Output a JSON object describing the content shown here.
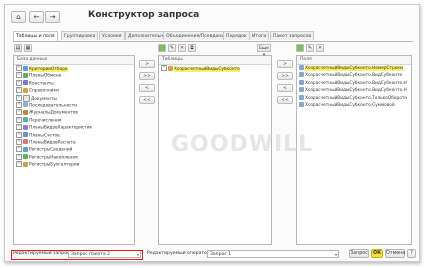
{
  "window": {
    "title": "Конструктор запроса",
    "nav_back": "←",
    "nav_forward": "→"
  },
  "tabs": [
    {
      "label": "Таблицы и поля"
    },
    {
      "label": "Группировка"
    },
    {
      "label": "Условия"
    },
    {
      "label": "Дополнительно"
    },
    {
      "label": "Объединения/Псевдонимы"
    },
    {
      "label": "Порядок"
    },
    {
      "label": "Итоги"
    },
    {
      "label": "Пакет запросов"
    }
  ],
  "left_panel": {
    "header": "База данных",
    "items": [
      {
        "label": "КритерииОтбора",
        "highlight": true
      },
      {
        "label": "ПланыОбмена"
      },
      {
        "label": "Константы"
      },
      {
        "label": "Справочники"
      },
      {
        "label": "Документы"
      },
      {
        "label": "Последовательности"
      },
      {
        "label": "ЖурналыДокументов"
      },
      {
        "label": "Перечисления"
      },
      {
        "label": "ПланыВидовХарактеристик"
      },
      {
        "label": "ПланыСчетов"
      },
      {
        "label": "ПланыВидовРасчета"
      },
      {
        "label": "РегистрыСведений"
      },
      {
        "label": "РегистрыНакопления"
      },
      {
        "label": "РегистрыБухгалтерии"
      }
    ]
  },
  "middle_buttons": [
    ">",
    ">>",
    "<",
    "<<"
  ],
  "right_buttons": [
    ">",
    ">>",
    "<",
    "<<"
  ],
  "tables_panel": {
    "header": "Таблицы",
    "items": [
      {
        "label": "ХозрасчетныйВидыСубконто",
        "highlight": true
      }
    ],
    "dropdown": "Еще"
  },
  "fields_panel": {
    "header": "Поля",
    "items": [
      {
        "label": "ХозрасчетныйВидыСубконто.НомерСтроки",
        "highlight": true
      },
      {
        "label": "ХозрасчетныйВидыСубконто.ВидСубконто"
      },
      {
        "label": "ХозрасчетныйВидыСубконто.ВидСубконто.Н"
      },
      {
        "label": "ХозрасчетныйВидыСубконто.ВидСубконто.Н"
      },
      {
        "label": "ХозрасчетныйВидыСубконто.ТолькоОборотн"
      },
      {
        "label": "ХозрасчетныйВидыСубконто.Суммовой"
      }
    ]
  },
  "watermark": {
    "text": "GOODWILL"
  },
  "bottom": {
    "query_label": "Редактируемый запрос:",
    "query_value": "Запрос пакета 2",
    "operator_label": "Редактируемый оператор:",
    "operator_value": "Запрос 1",
    "btn_query": "Запрос",
    "btn_ok": "ОК",
    "btn_cancel": "Отмена",
    "btn_help": "?"
  },
  "colors": {
    "highlight": "#f7f06b",
    "ok_button": "#f6e13a",
    "selection_frame": "#e01b1b"
  }
}
